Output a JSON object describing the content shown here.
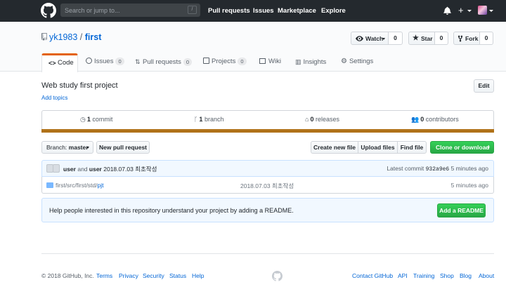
{
  "header": {
    "search_placeholder": "Search or jump to...",
    "search_key": "/",
    "nav": [
      "Pull requests",
      "Issues",
      "Marketplace",
      "Explore"
    ],
    "plus_label": "+"
  },
  "repo": {
    "owner": "yk1983",
    "separator": "/",
    "name": "first",
    "watch_label": "Watch",
    "watch_count": "0",
    "star_label": "Star",
    "star_count": "0",
    "fork_label": "Fork",
    "fork_count": "0"
  },
  "tabs": [
    {
      "label": "Code",
      "count": ""
    },
    {
      "label": "Issues",
      "count": "0"
    },
    {
      "label": "Pull requests",
      "count": "0"
    },
    {
      "label": "Projects",
      "count": "0"
    },
    {
      "label": "Wiki",
      "count": ""
    },
    {
      "label": "Insights",
      "count": ""
    },
    {
      "label": "Settings",
      "count": ""
    }
  ],
  "description": "Web study first project",
  "add_topics": "Add topics",
  "edit_label": "Edit",
  "summary": {
    "commits_num": "1",
    "commits_label": "commit",
    "branches_num": "1",
    "branches_label": "branch",
    "releases_num": "0",
    "releases_label": "releases",
    "contributors_num": "0",
    "contributors_label": "contributors"
  },
  "language_color": "#b07219",
  "toolbar": {
    "branch_label": "Branch:",
    "branch_value": "master",
    "new_pr": "New pull request",
    "create_file": "Create new file",
    "upload_files": "Upload files",
    "find_file": "Find file",
    "clone": "Clone or download"
  },
  "commit": {
    "author": "user",
    "and": "and",
    "committer": "user",
    "message": "2018.07.03 최초작성",
    "latest_label": "Latest commit",
    "sha": "932a9e6",
    "time": "5 minutes ago"
  },
  "files": [
    {
      "path_prefix": "first/src/first/std/",
      "path_last": "pjt",
      "message": "2018.07.03 최초작성",
      "time": "5 minutes ago"
    }
  ],
  "readme": {
    "text": "Help people interested in this repository understand your project by adding a README.",
    "button": "Add a README"
  },
  "footer": {
    "copyright": "© 2018 GitHub, Inc.",
    "left_links": [
      "Terms",
      "Privacy",
      "Security",
      "Status",
      "Help"
    ],
    "right_links": [
      "Contact GitHub",
      "API",
      "Training",
      "Shop",
      "Blog",
      "About"
    ]
  },
  "colors": {
    "header_bg": "#24292e",
    "link": "#0366d6",
    "selected_tab_accent": "#e36209",
    "primary_button": "#28a745"
  }
}
